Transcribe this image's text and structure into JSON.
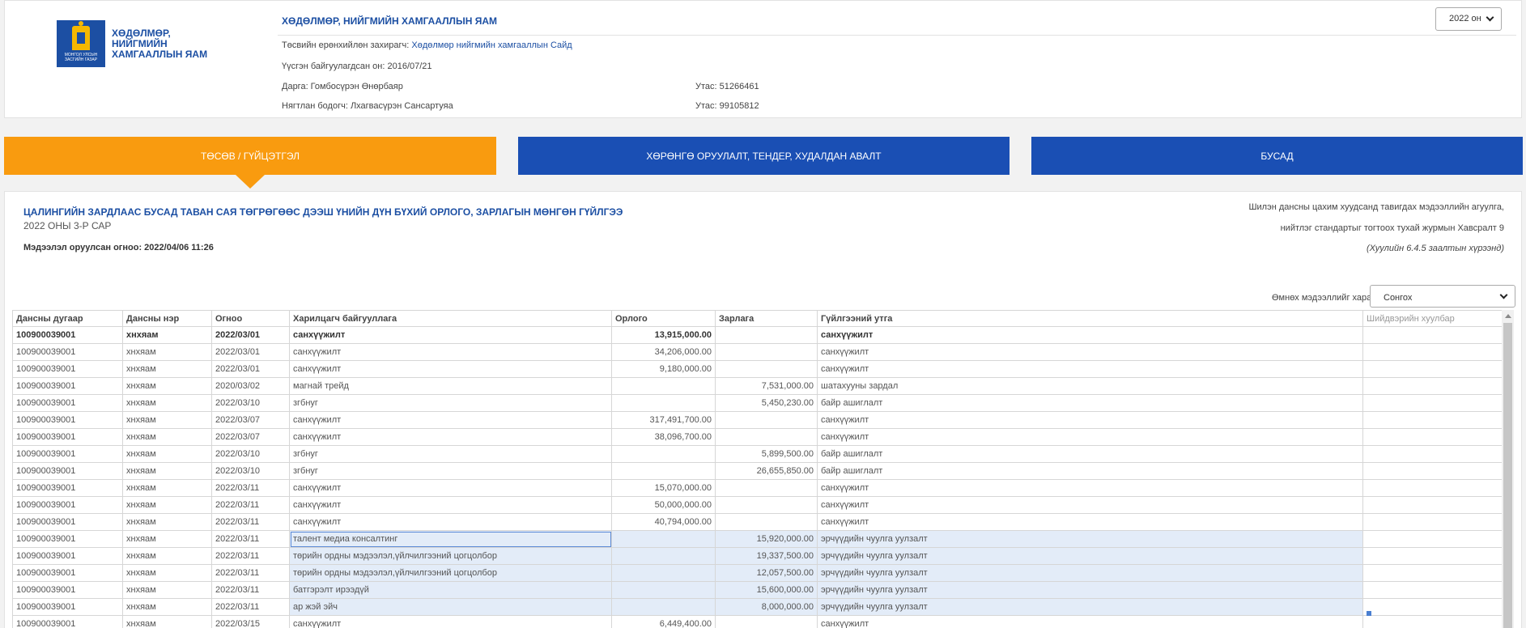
{
  "header": {
    "logo_caption": "МОНГОЛ УЛСЫН ЗАСГИЙН ГАЗАР",
    "logo_name": "ХӨДӨЛМӨР, НИЙГМИЙН ХАМГААЛЛЫН ЯАМ",
    "ministry_title": "ХӨДӨЛМӨР, НИЙГМИЙН ХАМГААЛЛЫН ЯАМ",
    "year_select": "2022 он",
    "info": {
      "budget_manager_label": "Төсвийн ерөнхийлөн захирагч:",
      "budget_manager_value": "Хөдөлмөр нийгмийн хамгааллын Сайд",
      "founded": "Үүсгэн байгуулагдсан он: 2016/07/21",
      "head": "Дарга: Гомбосүрэн Өнөрбаяр",
      "head_phone": "Утас: 51266461",
      "accountant": "Нягтлан бодогч: Лхагвасүрэн Сансартуяа",
      "accountant_phone": "Утас: 99105812"
    }
  },
  "tabs": [
    {
      "label": "ТӨСӨВ / ГҮЙЦЭТГЭЛ",
      "active": true
    },
    {
      "label": "ХӨРӨНГӨ ОРУУЛАЛТ, ТЕНДЕР, ХУДАЛДАН АВАЛТ",
      "active": false
    },
    {
      "label": "БУСАД",
      "active": false
    }
  ],
  "report": {
    "title": "ЦАЛИНГИЙН ЗАРДЛААС БУСАД ТАВАН САЯ ТӨГРӨГӨӨС ДЭЭШ ҮНИЙН ДҮН БҮХИЙ ОРЛОГО, ЗАРЛАГЫН МӨНГӨН ГҮЙЛГЭЭ",
    "subtitle": "2022 ОНЫ 3-Р САР",
    "updated": "Мэдээлэл оруулсан огноо: 2022/04/06 11:26",
    "legal_1": "Шилэн дансны цахим хуудсанд тавигдах мэдээллийн агуулга,",
    "legal_2": "нийтлэг стандартыг тогтоох тухай журмын Хавсралт 9",
    "legal_3": "(Хуулийн 6.4.5 заалтын хүрээнд)",
    "prev_label": "Өмнөх мэдээллийг харах",
    "prev_select": "Сонгох"
  },
  "table": {
    "columns": [
      "Дансны дугаар",
      "Дансны нэр",
      "Огноо",
      "Харилцагч байгууллага",
      "Орлого",
      "Зарлага",
      "Гүйлгээний утга",
      "Шийдвэрийн хуулбар"
    ],
    "rows": [
      [
        "100900039001",
        "хнхяам",
        "2022/03/01",
        "санхүүжилт",
        "13,915,000.00",
        "",
        "санхүүжилт",
        ""
      ],
      [
        "100900039001",
        "хнхяам",
        "2022/03/01",
        "санхүүжилт",
        "34,206,000.00",
        "",
        "санхүүжилт",
        ""
      ],
      [
        "100900039001",
        "хнхяам",
        "2022/03/01",
        "санхүүжилт",
        "9,180,000.00",
        "",
        "санхүүжилт",
        ""
      ],
      [
        "100900039001",
        "хнхяам",
        "2020/03/02",
        "магнай трейд",
        "",
        "7,531,000.00",
        "шатахууны зардал",
        ""
      ],
      [
        "100900039001",
        "хнхяам",
        "2022/03/10",
        "згбнуг",
        "",
        "5,450,230.00",
        "байр ашиглалт",
        ""
      ],
      [
        "100900039001",
        "хнхяам",
        "2022/03/07",
        "санхүүжилт",
        "317,491,700.00",
        "",
        "санхүүжилт",
        ""
      ],
      [
        "100900039001",
        "хнхяам",
        "2022/03/07",
        "санхүүжилт",
        "38,096,700.00",
        "",
        "санхүүжилт",
        ""
      ],
      [
        "100900039001",
        "хнхяам",
        "2022/03/10",
        "згбнуг",
        "",
        "5,899,500.00",
        "байр ашиглалт",
        ""
      ],
      [
        "100900039001",
        "хнхяам",
        "2022/03/10",
        "згбнуг",
        "",
        "26,655,850.00",
        "байр ашиглалт",
        ""
      ],
      [
        "100900039001",
        "хнхяам",
        "2022/03/11",
        "санхүүжилт",
        "15,070,000.00",
        "",
        "санхүүжилт",
        ""
      ],
      [
        "100900039001",
        "хнхяам",
        "2022/03/11",
        "санхүүжилт",
        "50,000,000.00",
        "",
        "санхүүжилт",
        ""
      ],
      [
        "100900039001",
        "хнхяам",
        "2022/03/11",
        "санхүүжилт",
        "40,794,000.00",
        "",
        "санхүүжилт",
        ""
      ],
      [
        "100900039001",
        "хнхяам",
        "2022/03/11",
        "талент медиа консалтинг",
        "",
        "15,920,000.00",
        "эрчүүдийн чуулга уулзалт",
        ""
      ],
      [
        "100900039001",
        "хнхяам",
        "2022/03/11",
        "төрийн ордны мэдээлэл,үйлчилгээний цогцолбор",
        "",
        "19,337,500.00",
        "эрчүүдийн чуулга уулзалт",
        ""
      ],
      [
        "100900039001",
        "хнхяам",
        "2022/03/11",
        "төрийн ордны мэдээлэл,үйлчилгээний цогцолбор",
        "",
        "12,057,500.00",
        "эрчүүдийн чуулга уулзалт",
        ""
      ],
      [
        "100900039001",
        "хнхяам",
        "2022/03/11",
        "батгэрэлт ирээдүй",
        "",
        "15,600,000.00",
        "эрчүүдийн чуулга уулзалт",
        ""
      ],
      [
        "100900039001",
        "хнхяам",
        "2022/03/11",
        "ар жэй эйч",
        "",
        "8,000,000.00",
        "эрчүүдийн чуулга уулзалт",
        ""
      ],
      [
        "100900039001",
        "хнхяам",
        "2022/03/15",
        "санхүүжилт",
        "6,449,400.00",
        "",
        "санхүүжилт",
        ""
      ]
    ]
  },
  "colors": {
    "active_tab": "#f99b0f",
    "inactive_tab": "#1a4fb4",
    "brand_blue": "#1c4fa3",
    "selection": "#e3ecf8"
  }
}
